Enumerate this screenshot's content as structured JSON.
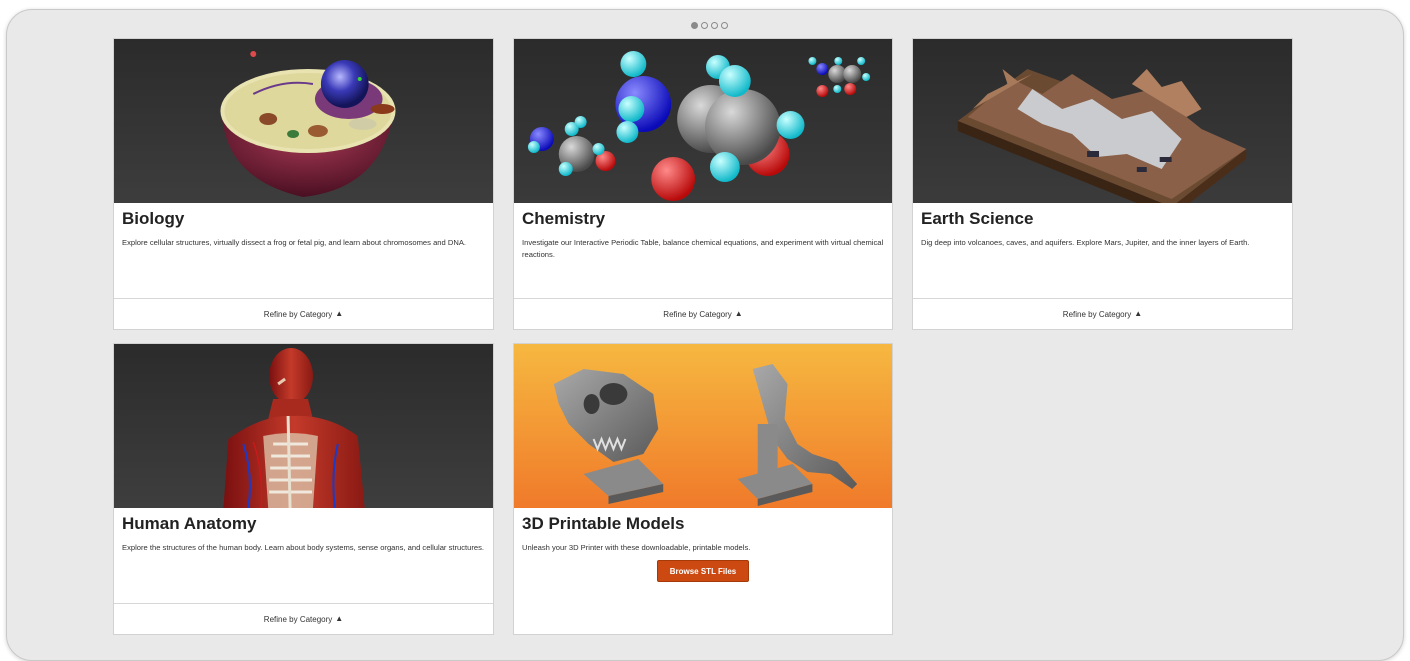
{
  "carousel": {
    "dots": [
      {
        "label": "slide-1",
        "active": true
      },
      {
        "label": "slide-2",
        "active": false
      },
      {
        "label": "slide-3",
        "active": false
      },
      {
        "label": "slide-4",
        "active": false
      }
    ]
  },
  "cards": [
    {
      "id": "biology",
      "title": "Biology",
      "description": "Explore cellular structures, virtually dissect a frog or fetal pig, and learn about chromosomes and DNA.",
      "footer_label": "Refine by Category",
      "image_icon": "animal-cell-icon"
    },
    {
      "id": "chemistry",
      "title": "Chemistry",
      "description": "Investigate our Interactive Periodic Table, balance chemical equations, and experiment with virtual chemical reactions.",
      "footer_label": "Refine by Category",
      "image_icon": "molecule-icon"
    },
    {
      "id": "earth-science",
      "title": "Earth Science",
      "description": "Dig deep into volcanoes, caves, and aquifers. Explore Mars, Jupiter, and the inner layers of Earth.",
      "footer_label": "Refine by Category",
      "image_icon": "terrain-icon"
    },
    {
      "id": "human-anatomy",
      "title": "Human Anatomy",
      "description": "Explore the structures of the human body. Learn about body systems, sense organs, and cellular structures.",
      "footer_label": "Refine by Category",
      "image_icon": "human-body-icon"
    },
    {
      "id": "3d-printable-models",
      "title": "3D Printable Models",
      "description": "Unleash your 3D Printer with these downloadable, printable models.",
      "button_label": "Browse STL Files",
      "image_icon": "skull-model-icon"
    }
  ],
  "colors": {
    "frame_background": "#e9e9e9",
    "dark_image_background": "#2a2a2a",
    "button_orange": "#cc4a12",
    "printable_gradient_top": "#f6b840",
    "printable_gradient_bottom": "#f07a2a"
  },
  "icons": {
    "chevron_up": "chevron-up-icon"
  }
}
